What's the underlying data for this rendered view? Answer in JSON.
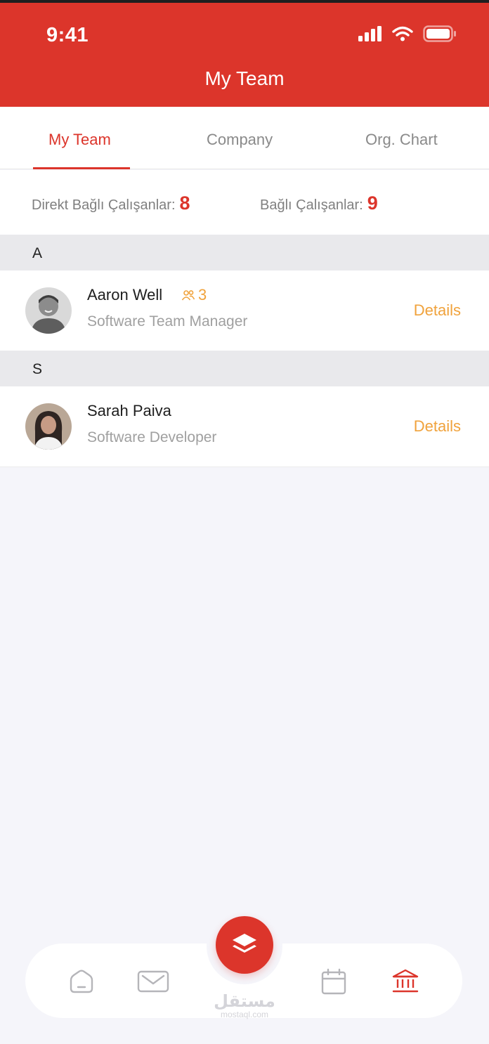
{
  "status_bar": {
    "time": "9:41"
  },
  "header": {
    "title": "My Team"
  },
  "tabs": [
    {
      "label": "My Team",
      "active": true
    },
    {
      "label": "Company",
      "active": false
    },
    {
      "label": "Org. Chart",
      "active": false
    }
  ],
  "counts": {
    "direct_label": "Direkt Bağlı Çalışanlar:",
    "direct_value": "8",
    "all_label": "Bağlı Çalışanlar:",
    "all_value": "9"
  },
  "sections": [
    {
      "letter": "A",
      "people": [
        {
          "name": "Aaron Well",
          "role": "Software Team Manager",
          "reports_icon": "people-icon",
          "reports": "3",
          "action": "Details"
        }
      ]
    },
    {
      "letter": "S",
      "people": [
        {
          "name": "Sarah Paiva",
          "role": "Software Developer",
          "action": "Details"
        }
      ]
    }
  ],
  "bottom_nav": {
    "items": [
      "home-icon",
      "mail-icon",
      "layers-icon",
      "calendar-icon",
      "bank-icon"
    ],
    "active": "bank-icon"
  },
  "watermark": {
    "arabic": "مستقل",
    "latin": "mostaql.com"
  },
  "colors": {
    "brand": "#dc352b",
    "accent": "#f0a23b",
    "background": "#f5f5fa"
  }
}
